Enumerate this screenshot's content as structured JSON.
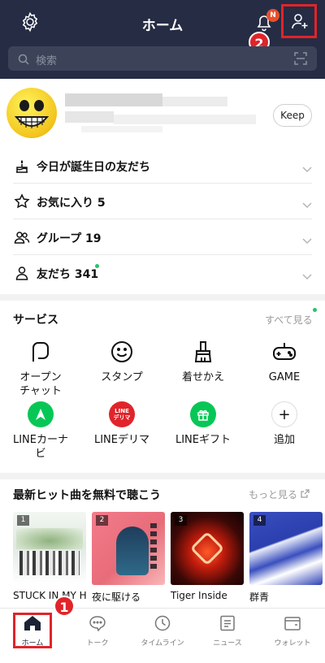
{
  "header": {
    "title": "ホーム",
    "bell_badge": "N",
    "marker_add": "2",
    "search_placeholder": "検索"
  },
  "profile": {
    "keep_label": "Keep"
  },
  "list": [
    {
      "label": "今日が誕生日の友だち"
    },
    {
      "label": "お気に入り 5"
    },
    {
      "label": "グループ 19"
    },
    {
      "label": "友だち 341"
    }
  ],
  "services": {
    "title": "サービス",
    "more": "すべて見る",
    "items": [
      {
        "label": "オープン\nチャット",
        "icon": "open-chat-icon"
      },
      {
        "label": "スタンプ",
        "icon": "sticker-icon"
      },
      {
        "label": "着せかえ",
        "icon": "theme-icon"
      },
      {
        "label": "GAME",
        "icon": "game-icon"
      },
      {
        "label": "LINEカーナ\nビ",
        "icon": "line-carnavi-icon"
      },
      {
        "label": "LINEデリマ",
        "icon": "line-delima-icon",
        "badge_text": "LINE\nデリマ"
      },
      {
        "label": "LINEギフト",
        "icon": "line-gift-icon"
      },
      {
        "label": "追加",
        "icon": "add-icon"
      }
    ]
  },
  "songs": {
    "title": "最新ヒット曲を無料で聴こう",
    "more": "もっと見る",
    "items": [
      {
        "num": "1",
        "title": "STUCK IN MY HEAD"
      },
      {
        "num": "2",
        "title": "夜に駆ける"
      },
      {
        "num": "3",
        "title": "Tiger Inside"
      },
      {
        "num": "4",
        "title": "群青"
      }
    ]
  },
  "nav": {
    "marker_home": "1",
    "items": [
      {
        "label": "ホーム",
        "icon": "home-icon"
      },
      {
        "label": "トーク",
        "icon": "talk-icon"
      },
      {
        "label": "タイムライン",
        "icon": "timeline-icon"
      },
      {
        "label": "ニュース",
        "icon": "news-icon"
      },
      {
        "label": "ウォレット",
        "icon": "wallet-icon"
      }
    ]
  },
  "colors": {
    "header_bg": "#252c44",
    "highlight_red": "#e0242a",
    "online_green": "#27c36a",
    "line_green": "#06c755"
  }
}
